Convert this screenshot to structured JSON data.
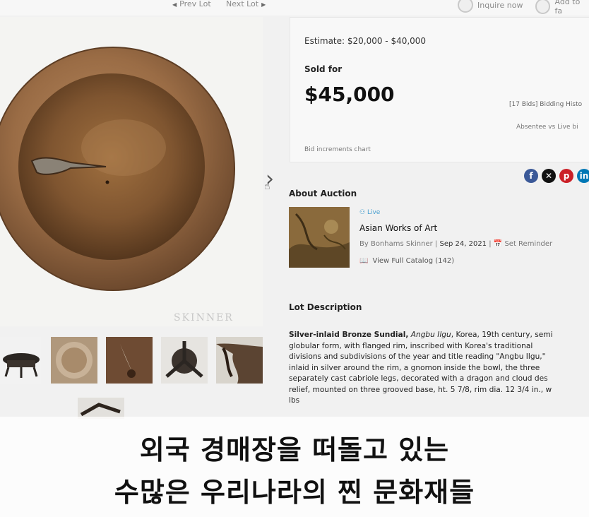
{
  "nav": {
    "prev_lot": "Prev Lot",
    "next_lot": "Next Lot",
    "inquire": "Inquire now",
    "add_to": "Add to fa"
  },
  "image": {
    "watermark": "SKINNER"
  },
  "pricing": {
    "estimate": "Estimate:  $20,000 - $40,000",
    "sold_for_label": "Sold for",
    "sold_price": "$45,000",
    "bids_text": "[17 Bids]  Bidding Histo",
    "absentee_text": "Absentee vs Live bi",
    "increments_link": "Bid increments chart"
  },
  "share": {
    "icons": [
      "facebook-icon",
      "x-icon",
      "pinterest-icon",
      "linkedin-icon"
    ],
    "colors": [
      "#3b5998",
      "#111111",
      "#cb2027",
      "#0077b5"
    ]
  },
  "auction": {
    "section_title": "About Auction",
    "live_badge": "Live",
    "name": "Asian Works of Art",
    "by": "By Bonhams Skinner",
    "date": "Sep 24, 2021",
    "reminder": "Set Reminder",
    "catalog": "View Full Catalog (142)"
  },
  "lot": {
    "section_title": "Lot Description",
    "title_bold": "Silver-inlaid Bronze Sundial,",
    "title_italic": "Angbu Ilgu",
    "lines": [
      ", Korea, 19th century, semi",
      "globular form, with flanged rim, inscribed with Korea's traditional",
      "divisions and subdivisions of the year and title reading \"Angbu Ilgu,\"",
      "inlaid in silver around the rim, a gnomon inside the bowl, the three",
      "separately cast cabriole legs, decorated with a dragon and cloud des",
      "relief, mounted on three grooved base, ht. 5 7/8, rim dia. 12 3/4 in., w",
      "lbs"
    ]
  },
  "subtitle": {
    "line1": "외국 경매장을 떠돌고 있는",
    "line2": "수많은 우리나라의 찐 문화재들"
  },
  "colors": {
    "bronze": "#8a5e3a",
    "accent_blue": "#4aa0d0"
  }
}
